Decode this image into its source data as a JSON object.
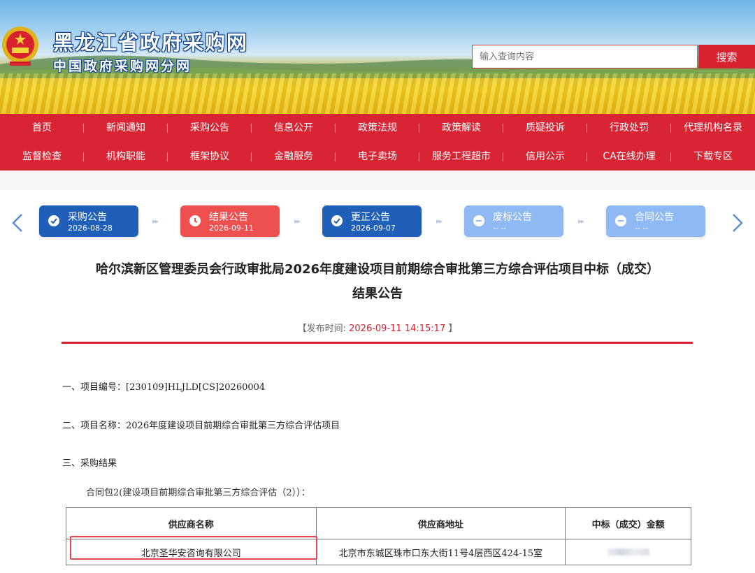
{
  "header": {
    "site_title": "黑龙江省政府采购网",
    "site_subtitle": "中国政府采购网分网",
    "search_placeholder": "输入查询内容",
    "search_button": "搜索"
  },
  "nav": {
    "row1": [
      "首页",
      "新闻通知",
      "采购公告",
      "信息公开",
      "政策法规",
      "政策解读",
      "质疑投诉",
      "行政处罚",
      "代理机构名录"
    ],
    "row2": [
      "监督检查",
      "机构职能",
      "框架协议",
      "金融服务",
      "电子卖场",
      "服务工程超市",
      "信用公示",
      "CA在线办理",
      "下载专区"
    ]
  },
  "steps": [
    {
      "label": "采购公告",
      "date": "2026-08-28",
      "status": "done"
    },
    {
      "label": "结果公告",
      "date": "2026-09-11",
      "status": "current"
    },
    {
      "label": "更正公告",
      "date": "2026-09-07",
      "status": "done"
    },
    {
      "label": "废标公告",
      "date": "-- --",
      "status": "inactive"
    },
    {
      "label": "合同公告",
      "date": "-- --",
      "status": "inactive"
    }
  ],
  "article": {
    "title_line1": "哈尔滨新区管理委员会行政审批局2026年度建设项目前期综合审批第三方综合评估项目中标（成交）",
    "title_line2": "结果公告",
    "pub_label": "【发布时间: ",
    "pub_time": "2026-09-11 14:15:17",
    "pub_end": " 】",
    "section1": "一、项目编号：[230109]HLJLD[CS]20260004",
    "section2": "二、项目名称：2026年度建设项目前期综合审批第三方综合评估项目",
    "section3": "三、采购结果",
    "package": "合同包2(建设项目前期综合审批第三方综合评估（2））："
  },
  "table": {
    "headers": [
      "供应商名称",
      "供应商地址",
      "中标（成交）金额"
    ],
    "rows": [
      [
        "北京圣华安咨询有限公司",
        "北京市东城区珠市口东大街11号4层西区424-15室",
        ""
      ]
    ]
  },
  "colors": {
    "brand_red": "#d8222f",
    "step_blue": "#1f5fb8",
    "step_red": "#ee4f4f",
    "step_inactive": "#8fb9f2"
  }
}
